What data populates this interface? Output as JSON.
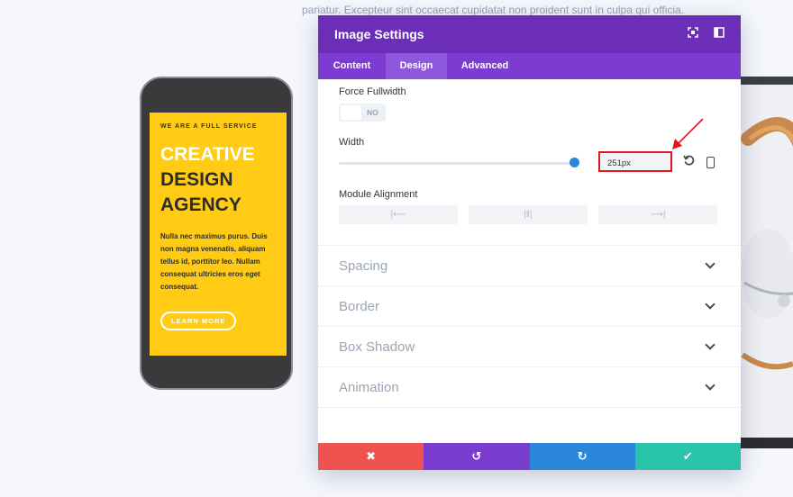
{
  "background": {
    "text": "pariatur. Excepteur sint occaecat cupidatat non proident sunt in culpa qui officia."
  },
  "phone": {
    "tagline": "WE ARE A FULL SERVICE",
    "heading_line1": "CREATIVE",
    "heading_line2": "DESIGN",
    "heading_line3": "AGENCY",
    "body": "Nulla nec maximus purus. Duis non magna venenatis, aliquam tellus id, porttitor leo. Nullam consequat ultricies eros eget consequat.",
    "button_label": "LEARN MORE",
    "screen_color": "#ffcb14"
  },
  "modal": {
    "title": "Image Settings",
    "header_icons": [
      "expand-icon",
      "sidebar-icon"
    ],
    "tabs": [
      {
        "label": "Content",
        "active": false
      },
      {
        "label": "Design",
        "active": true
      },
      {
        "label": "Advanced",
        "active": false
      }
    ],
    "force_fullwidth": {
      "label": "Force Fullwidth",
      "toggle_text": "NO"
    },
    "width": {
      "label": "Width",
      "value": "251px",
      "slider_fraction": 1.0
    },
    "module_alignment": {
      "label": "Module Alignment",
      "options": [
        "align-left-icon",
        "align-center-icon",
        "align-right-icon"
      ]
    },
    "sections": [
      "Spacing",
      "Border",
      "Box Shadow",
      "Animation"
    ],
    "footer": {
      "cancel_icon": "✖",
      "undo_icon": "↺",
      "redo_icon": "↻",
      "save_icon": "✔"
    }
  },
  "colors": {
    "header": "#6c2eb9",
    "tabs": "#7d3bd1",
    "cancel": "#ef5350",
    "undo": "#7b3dd0",
    "redo": "#2b87da",
    "save": "#29c4a9",
    "highlight": "#e0161d"
  }
}
